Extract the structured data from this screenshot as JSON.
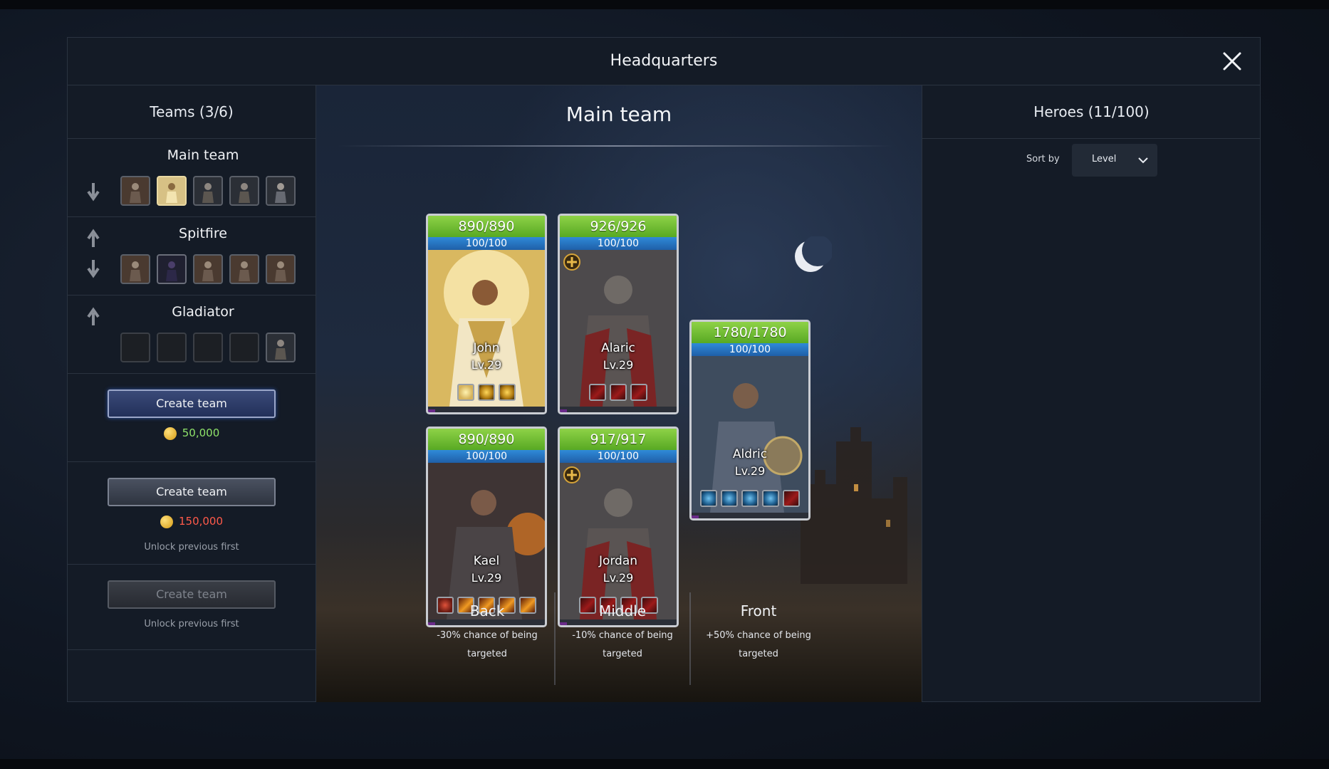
{
  "modal": {
    "title": "Headquarters"
  },
  "teams_panel": {
    "title": "Teams (3/6)",
    "teams": [
      {
        "name": "Main team"
      },
      {
        "name": "Spitfire"
      },
      {
        "name": "Gladiator"
      }
    ],
    "create": [
      {
        "label": "Create team",
        "price": "50,000",
        "price_color": "#8fe36a"
      },
      {
        "label": "Create team",
        "price": "150,000",
        "price_color": "#ff5a4a",
        "note": "Unlock previous first"
      },
      {
        "label": "Create team",
        "note": "Unlock previous first"
      }
    ]
  },
  "main": {
    "title": "Main team",
    "heroes": [
      {
        "name": "John",
        "level": "Lv.29",
        "hp": "890/890",
        "mp": "100/100",
        "skills": [
          "light",
          "gold",
          "gold"
        ]
      },
      {
        "name": "Alaric",
        "level": "Lv.29",
        "hp": "926/926",
        "mp": "100/100",
        "skills": [
          "red",
          "red",
          "red"
        ]
      },
      {
        "name": "Kael",
        "level": "Lv.29",
        "hp": "890/890",
        "mp": "100/100",
        "skills": [
          "target",
          "fire",
          "fire",
          "fire",
          "fire"
        ]
      },
      {
        "name": "Jordan",
        "level": "Lv.29",
        "hp": "917/917",
        "mp": "100/100",
        "skills": [
          "red",
          "red",
          "red",
          "red"
        ]
      },
      {
        "name": "Aldric",
        "level": "Lv.29",
        "hp": "1780/1780",
        "mp": "100/100",
        "skills": [
          "blue",
          "blue",
          "blue",
          "blue",
          "red"
        ]
      }
    ],
    "positions": [
      {
        "name": "Back",
        "desc": "-30% chance of being targeted"
      },
      {
        "name": "Middle",
        "desc": "-10% chance of being targeted"
      },
      {
        "name": "Front",
        "desc": "+50% chance of being targeted"
      }
    ]
  },
  "heroes_panel": {
    "title": "Heroes (11/100)",
    "sort_label": "Sort by",
    "sort_value": "Level"
  },
  "icons": {
    "close": "close-icon",
    "arrow_up": "arrow-up-icon",
    "arrow_down": "arrow-down-icon",
    "coin": "coin-icon",
    "chevron": "chevron-down-icon",
    "badge": "holy-cross-badge-icon"
  }
}
